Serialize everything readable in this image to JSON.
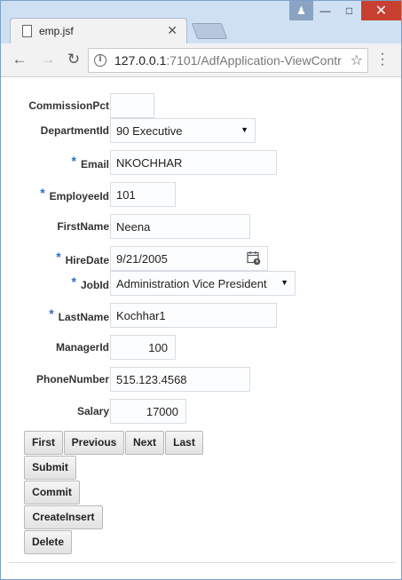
{
  "browser": {
    "tab_title": "emp.jsf",
    "url_host": "127.0.0.1",
    "url_path": ":7101/AdfApplication-ViewContr"
  },
  "form": {
    "commission_pct": {
      "label": "CommissionPct",
      "value": ""
    },
    "department_id": {
      "label": "DepartmentId",
      "value": "90 Executive"
    },
    "email": {
      "label": "Email",
      "value": "NKOCHHAR",
      "required_mark": "*"
    },
    "employee_id": {
      "label": "EmployeeId",
      "value": "101",
      "required_mark": "*"
    },
    "first_name": {
      "label": "FirstName",
      "value": "Neena"
    },
    "hire_date": {
      "label": "HireDate",
      "value": "9/21/2005",
      "required_mark": "*"
    },
    "job_id": {
      "label": "JobId",
      "value": "Administration Vice President",
      "required_mark": "*"
    },
    "last_name": {
      "label": "LastName",
      "value": "Kochhar1",
      "required_mark": "*"
    },
    "manager_id": {
      "label": "ManagerId",
      "value": "100"
    },
    "phone_number": {
      "label": "PhoneNumber",
      "value": "515.123.4568"
    },
    "salary": {
      "label": "Salary",
      "value": "17000"
    }
  },
  "buttons": {
    "first": "First",
    "previous": "Previous",
    "next": "Next",
    "last": "Last",
    "submit": "Submit",
    "commit": "Commit",
    "create_insert": "CreateInsert",
    "delete": "Delete"
  },
  "icons": {
    "back": "arrow-left-icon",
    "forward": "arrow-right-icon",
    "reload": "reload-icon",
    "info": "info-icon",
    "bookmark": "star-icon",
    "menu": "kebab-menu-icon",
    "calendar": "calendar-icon",
    "dropdown": "caret-down-icon"
  },
  "colors": {
    "required_mark": "#2d6dc3",
    "close_button": "#c84031",
    "titlebar": "#cfe0f3"
  }
}
